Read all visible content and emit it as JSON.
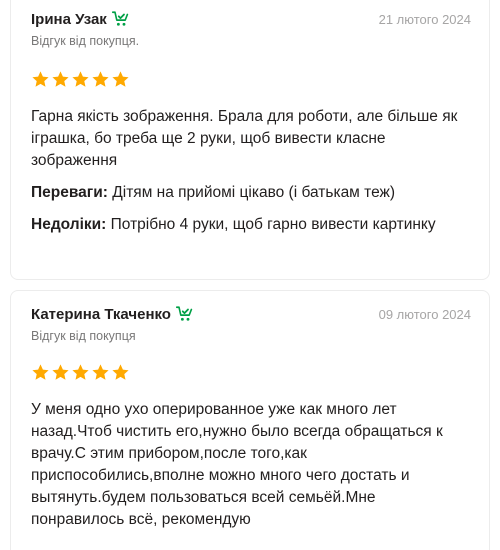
{
  "reviews": [
    {
      "author": "Ірина Узак",
      "date": "21 лютого 2024",
      "badge": "Відгук від покупця.",
      "rating": 5,
      "text": "Гарна якість зображення. Брала для роботи, але більше як іграшка, бо треба ще 2 руки, щоб вивести класне зображення",
      "pros_label": "Переваги:",
      "pros": "Дітям на прийомі цікаво (і батькам теж)",
      "cons_label": "Недоліки:",
      "cons": "Потрібно 4 руки, щоб гарно вивести картинку"
    },
    {
      "author": "Катерина Ткаченко",
      "date": "09 лютого 2024",
      "badge": "Відгук від покупця",
      "rating": 5,
      "text": "У меня одно ухо оперированное уже как много лет назад.Чтоб чистить его,нужно было всегда обращаться к врачу.С этим прибором,после того,как приспособились,вполне можно много чего достать и вытянуть.будем пользоваться всей семьёй.Мне понравилось всё, рекомендую"
    }
  ],
  "colors": {
    "star": "#ffa900",
    "buyer_icon": "#00a046",
    "text": "#221f1f",
    "muted": "#797878",
    "date": "#a6a5a5"
  },
  "icons": {
    "buyer": "shopping-cart-check-icon",
    "star": "star-icon"
  }
}
